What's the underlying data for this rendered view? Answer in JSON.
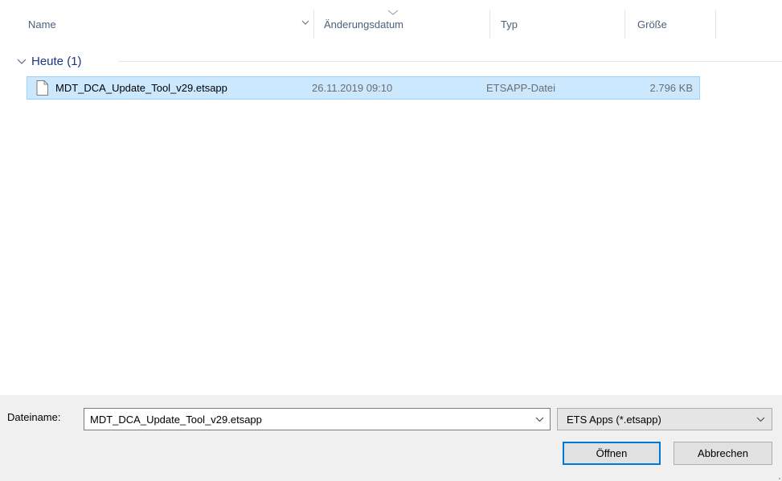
{
  "columns": {
    "name": "Name",
    "date": "Änderungsdatum",
    "type": "Typ",
    "size": "Größe"
  },
  "group": {
    "label": "Heute (1)"
  },
  "files": [
    {
      "name": "MDT_DCA_Update_Tool_v29.etsapp",
      "date": "26.11.2019 09:10",
      "type": "ETSAPP-Datei",
      "size": "2.796 KB",
      "selected": true
    }
  ],
  "footer": {
    "filename_label": "Dateiname:",
    "filename_value": "MDT_DCA_Update_Tool_v29.etsapp",
    "filter_value": "ETS Apps (*.etsapp)",
    "open_button": "Öffnen",
    "cancel_button": "Abbrechen"
  },
  "colors": {
    "selection_bg": "#cce8ff",
    "selection_border": "#99d1ff",
    "group_text": "#1e3287",
    "header_text": "#4c607a",
    "default_button_border": "#0078d7"
  }
}
